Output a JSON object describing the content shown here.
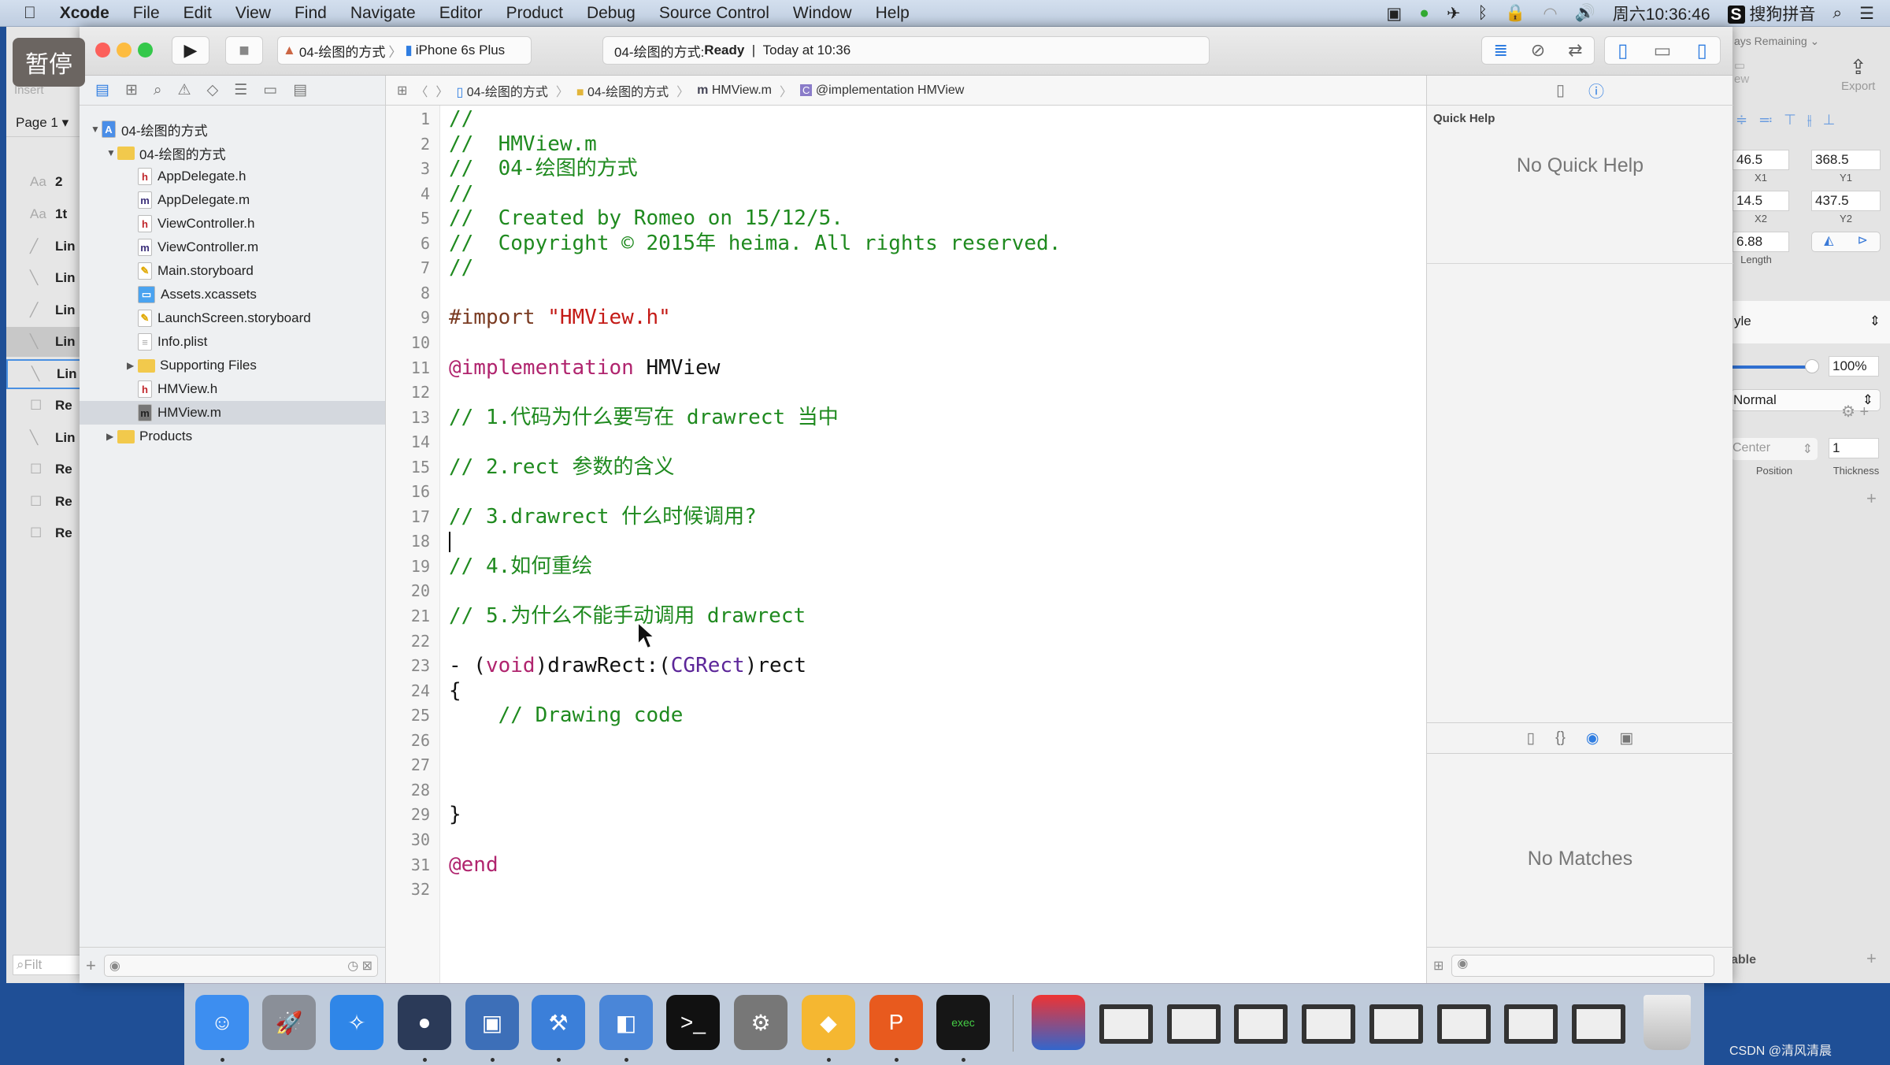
{
  "menubar": {
    "items": [
      "Xcode",
      "File",
      "Edit",
      "View",
      "Find",
      "Navigate",
      "Editor",
      "Product",
      "Debug",
      "Source Control",
      "Window",
      "Help"
    ],
    "clock": "周六10:36:46",
    "ime": "搜狗拼音"
  },
  "overlay": {
    "pause": "暂停"
  },
  "toolbar": {
    "scheme": "04-绘图的方式",
    "device": "iPhone 6s Plus",
    "status_project": "04-绘图的方式: ",
    "status_state": "Ready",
    "status_sep": "|",
    "status_time": "Today at 10:36"
  },
  "jumpbar": [
    "04-绘图的方式",
    "04-绘图的方式",
    "HMView.m",
    "@implementation HMView"
  ],
  "navigator": {
    "items": [
      {
        "label": "04-绘图的方式",
        "kind": "project",
        "level": 0,
        "open": true
      },
      {
        "label": "04-绘图的方式",
        "kind": "folder",
        "level": 1,
        "open": true
      },
      {
        "label": "AppDelegate.h",
        "kind": "h",
        "level": 2
      },
      {
        "label": "AppDelegate.m",
        "kind": "m",
        "level": 2
      },
      {
        "label": "ViewController.h",
        "kind": "h",
        "level": 2
      },
      {
        "label": "ViewController.m",
        "kind": "m",
        "level": 2
      },
      {
        "label": "Main.storyboard",
        "kind": "sb",
        "level": 2
      },
      {
        "label": "Assets.xcassets",
        "kind": "assets",
        "level": 2
      },
      {
        "label": "LaunchScreen.storyboard",
        "kind": "sb",
        "level": 2
      },
      {
        "label": "Info.plist",
        "kind": "plist",
        "level": 2
      },
      {
        "label": "Supporting Files",
        "kind": "folder",
        "level": 2,
        "open": false
      },
      {
        "label": "HMView.h",
        "kind": "h",
        "level": 2
      },
      {
        "label": "HMView.m",
        "kind": "m",
        "level": 2,
        "selected": true
      },
      {
        "label": "Products",
        "kind": "folder",
        "level": 1,
        "open": false
      }
    ]
  },
  "editor": {
    "lines": [
      [
        [
          "c",
          "//"
        ]
      ],
      [
        [
          "c",
          "//  HMView.m"
        ]
      ],
      [
        [
          "c",
          "//  04-绘图的方式"
        ]
      ],
      [
        [
          "c",
          "//"
        ]
      ],
      [
        [
          "c",
          "//  Created by Romeo on 15/12/5."
        ]
      ],
      [
        [
          "c",
          "//  Copyright © 2015年 heima. All rights reserved."
        ]
      ],
      [
        [
          "c",
          "//"
        ]
      ],
      [],
      [
        [
          "pp",
          "#import "
        ],
        [
          "str",
          "\"HMView.h\""
        ]
      ],
      [],
      [
        [
          "kw",
          "@implementation"
        ],
        [
          "pl",
          " HMView"
        ]
      ],
      [],
      [
        [
          "c",
          "// 1.代码为什么要写在 drawrect 当中"
        ]
      ],
      [],
      [
        [
          "c",
          "// 2.rect 参数的含义"
        ]
      ],
      [],
      [
        [
          "c",
          "// 3.drawrect 什么时候调用?"
        ]
      ],
      [],
      [
        [
          "c",
          "// 4.如何重绘"
        ]
      ],
      [],
      [
        [
          "c",
          "// 5.为什么不能手动调用 drawrect"
        ]
      ],
      [],
      [
        [
          "pl",
          "- ("
        ],
        [
          "kw",
          "void"
        ],
        [
          "pl",
          ")drawRect:("
        ],
        [
          "ty",
          "CGRect"
        ],
        [
          "pl",
          ")rect"
        ]
      ],
      [
        [
          "pl",
          "{"
        ]
      ],
      [
        [
          "c",
          "    // Drawing code"
        ]
      ],
      [],
      [],
      [],
      [
        [
          "pl",
          "}"
        ]
      ],
      [],
      [
        [
          "kw",
          "@end"
        ]
      ],
      []
    ],
    "cursor_line": 18
  },
  "utilities": {
    "quick_help_title": "Quick Help",
    "no_quick_help": "No Quick Help",
    "no_matches": "No Matches"
  },
  "sketch_left": {
    "insert": "Insert",
    "page": "Page 1",
    "filter": "Filt",
    "layers": [
      {
        "icon": "Aa",
        "label": "2"
      },
      {
        "icon": "Aa",
        "label": "1t"
      },
      {
        "icon": "line-up",
        "label": "Lin"
      },
      {
        "icon": "line-down",
        "label": "Lin"
      },
      {
        "icon": "line-up",
        "label": "Lin"
      },
      {
        "icon": "line-down",
        "label": "Lin",
        "state": "highlighted"
      },
      {
        "icon": "line-down",
        "label": "Lin",
        "state": "selected"
      },
      {
        "icon": "rect",
        "label": "Re"
      },
      {
        "icon": "line-down",
        "label": "Lin"
      },
      {
        "icon": "rect",
        "label": "Re"
      },
      {
        "icon": "rect",
        "label": "Re"
      },
      {
        "icon": "rect",
        "label": "Re"
      }
    ]
  },
  "sketch_right": {
    "trial": "ays Remaining",
    "view": "ew",
    "export": "Export",
    "x1": "46.5",
    "x1_label": "X1",
    "y1": "368.5",
    "y1_label": "Y1",
    "x2": "14.5",
    "x2_label": "X2",
    "y2": "437.5",
    "y2_label": "Y2",
    "length": "6.88",
    "length_label": "Length",
    "style": "yle",
    "opacity": "100%",
    "opacity_value": 1.0,
    "blend": "Normal",
    "position": "Center",
    "position_label": "Position",
    "thickness": "1",
    "thickness_label": "Thickness",
    "table": "able"
  },
  "dock": {
    "apps": [
      {
        "name": "finder",
        "color": "#3d8ef0",
        "glyph": "☺",
        "running": true
      },
      {
        "name": "launchpad",
        "color": "#8a8f98",
        "glyph": "🚀",
        "running": false
      },
      {
        "name": "safari",
        "color": "#2f86e8",
        "glyph": "✧",
        "running": false
      },
      {
        "name": "mouse-app",
        "color": "#2b3a58",
        "glyph": "●",
        "running": true
      },
      {
        "name": "photo-booth",
        "color": "#3d6fb8",
        "glyph": "▣",
        "running": true
      },
      {
        "name": "xcode",
        "color": "#3b7fd9",
        "glyph": "⚒",
        "running": true
      },
      {
        "name": "instruments",
        "color": "#4a86d8",
        "glyph": "◧",
        "running": true
      },
      {
        "name": "terminal",
        "color": "#111",
        "glyph": ">_",
        "running": false
      },
      {
        "name": "system-preferences",
        "color": "#777",
        "glyph": "⚙",
        "running": false
      },
      {
        "name": "sketch",
        "color": "#f5b731",
        "glyph": "◆",
        "running": true
      },
      {
        "name": "p-app",
        "color": "#e85a1e",
        "glyph": "P",
        "running": true
      },
      {
        "name": "console",
        "color": "#161616",
        "glyph": "exec",
        "running": true
      }
    ],
    "minimized": [
      "video-player",
      "window-1",
      "window-2",
      "window-3",
      "window-4",
      "window-5",
      "window-6",
      "window-7",
      "window-8"
    ],
    "trash": "trash"
  },
  "watermark": "CSDN @清风清晨",
  "colors": {
    "desktop": "#1f4f96",
    "comment": "#1f8a1f",
    "keyword": "#b0246e",
    "type": "#5c2699",
    "string": "#c41a16",
    "selection": "#d4d8de",
    "accent": "#2f7de1"
  }
}
